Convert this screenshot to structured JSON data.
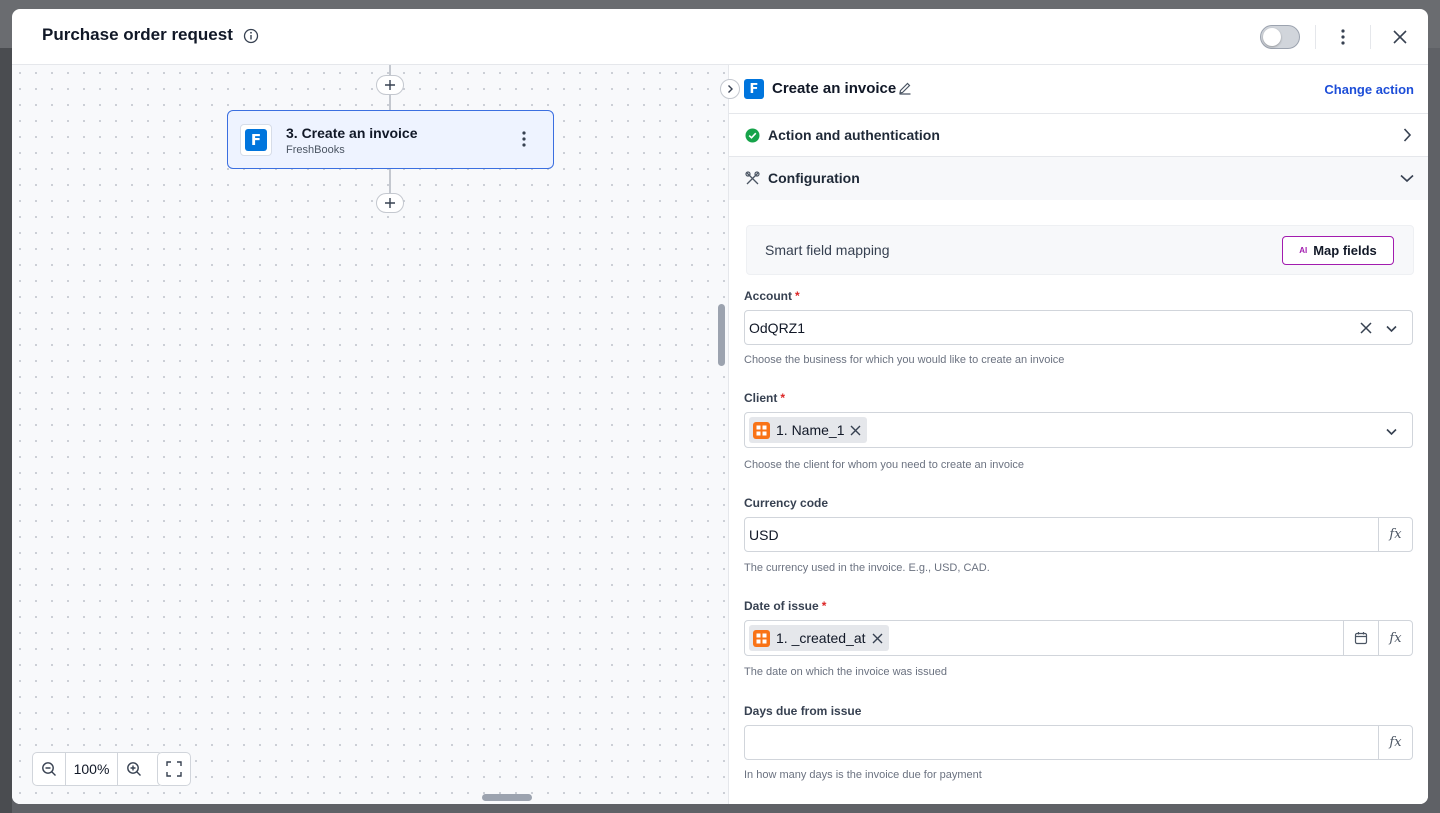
{
  "header": {
    "title": "Purchase order request"
  },
  "canvas": {
    "node": {
      "title": "3. Create an invoice",
      "subtitle": "FreshBooks",
      "logo_letter": "F"
    },
    "zoom_level": "100%"
  },
  "panel": {
    "logo_letter": "F",
    "title": "Create an invoice",
    "change_action_label": "Change action",
    "sections": {
      "action_auth": "Action and authentication",
      "configuration": "Configuration"
    },
    "smart_mapping": {
      "label": "Smart field mapping",
      "button_label": "Map fields",
      "ai_badge": "AI"
    },
    "fields": {
      "account": {
        "label": "Account",
        "value": "OdQRZ1",
        "help": "Choose the business for which you would like to create an invoice"
      },
      "client": {
        "label": "Client",
        "chip": "1. Name_1",
        "help": "Choose the client for whom you need to create an invoice"
      },
      "currency": {
        "label": "Currency code",
        "value": "USD",
        "help": "The currency used in the invoice. E.g., USD, CAD.",
        "fx": "fx"
      },
      "date_of_issue": {
        "label": "Date of issue",
        "chip": "1. _created_at",
        "help": "The date on which the invoice was issued",
        "fx": "fx"
      },
      "days_due": {
        "label": "Days due from issue",
        "value": "",
        "help": "In how many days is the invoice due for payment",
        "fx": "fx"
      }
    }
  },
  "colors": {
    "accent_blue": "#1d4ed8",
    "node_border": "#3b6fe0",
    "freshbooks_blue": "#0075dd",
    "success_green": "#16a34a",
    "required_red": "#dc2626",
    "ai_magenta": "#a21caf",
    "chip_orange": "#f97316"
  }
}
